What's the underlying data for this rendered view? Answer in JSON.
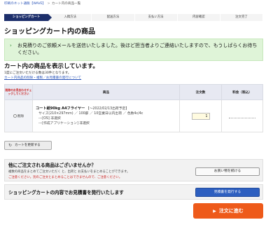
{
  "breadcrumb": {
    "home": "印刷のネット通販【WAVE】",
    "separator": ">",
    "current": "カート内の商品一覧"
  },
  "steps": [
    "ショッピングカート",
    "入稿方法",
    "配送方法",
    "支払い方法",
    "内容確認",
    "注文完了"
  ],
  "page_title": "ショッピングカート内の商品",
  "notice": {
    "text": "お見積りのご依頼メールを送信いたしました。後ほど担当者よりご連絡いたしますので、もうしばらくお待ちください。"
  },
  "cart": {
    "section_title": "カート内の商品を表示しています。",
    "note": "1度にご注文いただける数は30件となります。",
    "help_link": "カート内商品の削除・複製／お見積書の発行について",
    "columns": {
      "delete": "削除のお見合わせチェックしてください",
      "product": "商品",
      "quantity": "注文数",
      "price": "料金（税込）"
    },
    "items": [
      {
        "delete_label": "削除",
        "name": "コート紙90kg A4フライヤー",
        "date": "【〜2022/02/13出荷予定】",
        "spec": "サイズ(210×297mm) ／ 100部 ／ 10営業日以内出荷 ／ 色数4c/4c",
        "option1": "---[OS] 非選択",
        "option2": "---[作成アプリケーション] 非選択",
        "quantity": "1",
        "price": ""
      }
    ],
    "change_button": "カートを更新する"
  },
  "other_products": {
    "title": "他にご注文される商品はございませんか？",
    "text": "複数の商品をまとめてご注文いただく と、出荷と お支払いをまとめることができます。",
    "note": "ご注意ください。別のご注文とまとめることはできませんので、ご注意ください。",
    "button": "お買い物を続ける"
  },
  "estimate": {
    "title": "ショッピングカートの内容でお見積書を発行いたします",
    "button": "見積書を発行する"
  },
  "order_button": "注文に進む",
  "colors": {
    "accent": "#1d2f6b",
    "notice_bg": "#dff4d8",
    "order": "#ee5a1a",
    "estimate": "#2d5fc0"
  }
}
